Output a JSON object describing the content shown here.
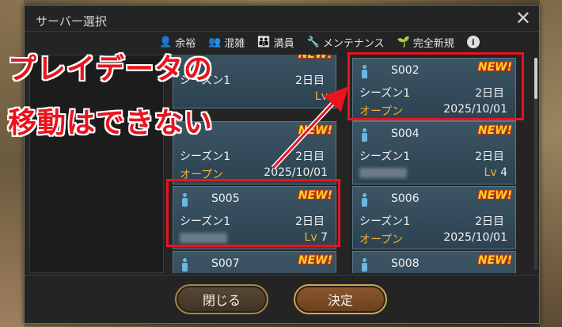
{
  "dialog": {
    "title": "サーバー選択",
    "close_glyph": "✕"
  },
  "legend": [
    {
      "icon": "person-icon",
      "icon_glyph": "👤",
      "label": "余裕",
      "color": "#6ab8e0"
    },
    {
      "icon": "people-icon",
      "icon_glyph": "👥",
      "label": "混雑",
      "color": "#e8c53a"
    },
    {
      "icon": "crowd-icon",
      "icon_glyph": "👪",
      "label": "満員",
      "color": "#e64a4a"
    },
    {
      "icon": "wrench-icon",
      "icon_glyph": "🔧",
      "label": "メンテナンス",
      "color": "#e0e0e0"
    },
    {
      "icon": "sprout-icon",
      "icon_glyph": "🌱",
      "label": "完全新規",
      "color": "#9ad05a"
    }
  ],
  "info_glyph": "i",
  "servers": [
    {
      "id": "",
      "season": "シーズン1",
      "day": "2日目",
      "status": "",
      "date": "",
      "level": "Lv",
      "level_value": "",
      "badge": "NEW!"
    },
    {
      "id": "S002",
      "season": "シーズン1",
      "day": "2日目",
      "status": "オープン",
      "date": "2025/10/01",
      "badge": "NEW!"
    },
    {
      "id": "",
      "season": "シーズン1",
      "day": "2日目",
      "status": "オープン",
      "date": "2025/10/01",
      "badge": "NEW!"
    },
    {
      "id": "S004",
      "season": "シーズン1",
      "day": "2日目",
      "level": "Lv",
      "level_value": "4",
      "badge": "NEW!"
    },
    {
      "id": "S005",
      "season": "シーズン1",
      "day": "2日目",
      "level": "Lv",
      "level_value": "7",
      "badge": "NEW!"
    },
    {
      "id": "S006",
      "season": "シーズン1",
      "day": "2日目",
      "status": "オープン",
      "date": "2025/10/01",
      "badge": "NEW!"
    },
    {
      "id": "S007",
      "badge": "NEW!"
    },
    {
      "id": "S008",
      "badge": "NEW!"
    }
  ],
  "buttons": {
    "close": "閉じる",
    "confirm": "決定"
  },
  "annotation": {
    "line1": "プレイデータの",
    "line2": "移動はできない",
    "color": "#e8141e"
  }
}
